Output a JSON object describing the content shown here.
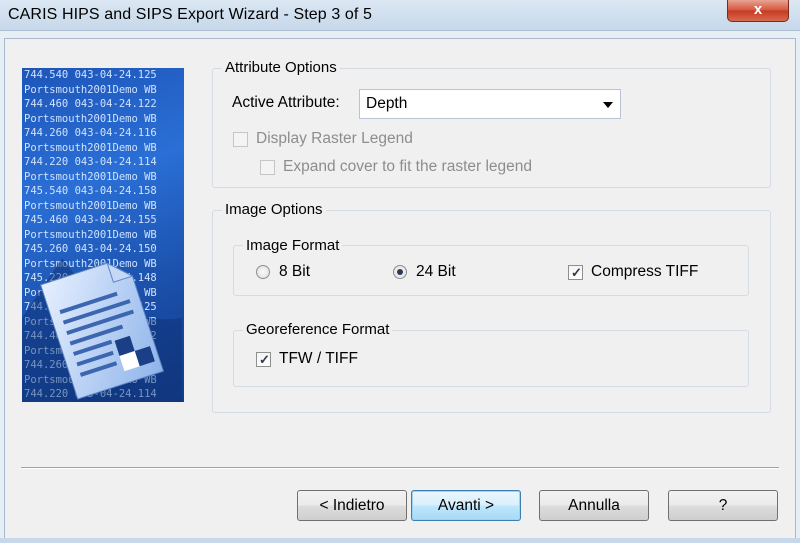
{
  "window": {
    "title": "CARIS HIPS and SIPS Export Wizard - Step 3 of 5",
    "close_label": "x"
  },
  "banner": {
    "lines": [
      "744.540 043-04-24.125",
      "Portsmouth2001Demo WB",
      "744.460 043-04-24.122",
      "Portsmouth2001Demo WB",
      "744.260 043-04-24.116",
      "Portsmouth2001Demo WB",
      "744.220 043-04-24.114",
      "Portsmouth2001Demo WB",
      "745.540 043-04-24.158",
      "Portsmouth2001Demo WB",
      "745.460 043-04-24.155",
      "Portsmouth2001Demo WB",
      "745.260 043-04-24.150",
      "Portsmouth2001Demo WB",
      "745.220 043-04-24.148",
      "Portsmouth2001Demo WB",
      "744.540 043-04-24.125",
      "Portsmouth2001Demo WB",
      "744.460 043-04-24.122",
      "Portsmouth2001Demo WB",
      "744.260 043-04-24.116",
      "Portsmouth2001Demo WB",
      "744.220 043-04-24.114",
      "Portsmouth2001Demo WB"
    ]
  },
  "attribute_options": {
    "title": "Attribute Options",
    "active_attribute_label": "Active Attribute:",
    "active_attribute_value": "Depth",
    "display_raster_legend_label": "Display Raster Legend",
    "display_raster_legend_checked": false,
    "expand_cover_label": "Expand cover to fit the raster legend",
    "expand_cover_checked": false
  },
  "image_options": {
    "title": "Image Options",
    "image_format": {
      "title": "Image Format",
      "option_8bit": "8 Bit",
      "option_24bit": "24 Bit",
      "selected": "24 Bit",
      "compress_tiff_label": "Compress TIFF",
      "compress_tiff_checked": true
    },
    "georeference_format": {
      "title": "Georeference Format",
      "tfw_tiff_label": "TFW / TIFF",
      "tfw_tiff_checked": true
    }
  },
  "buttons": {
    "back": "< Indietro",
    "next": "Avanti >",
    "cancel": "Annulla",
    "help": "?"
  },
  "colors": {
    "banner_blue": "#2a6fd6",
    "default_button_border": "#3c7fb1"
  }
}
